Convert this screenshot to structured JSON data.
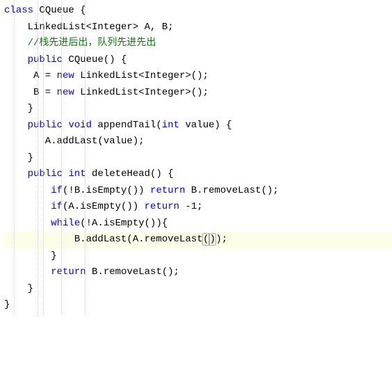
{
  "code": {
    "l1_kw_class": "class",
    "l1_name": " CQueue {",
    "l2_pre": "    LinkedList<Integer> A, B;",
    "l3_cmt": "    //栈先进后出，队列先进先出",
    "l4_a": "    ",
    "l4_kw": "public",
    "l4_b": " CQueue() {",
    "l5_a": "     A = ",
    "l5_kw": "new",
    "l5_b": " LinkedList<Integer>();",
    "l6_a": "     B = ",
    "l6_kw": "new",
    "l6_b": " LinkedList<Integer>();",
    "l7": "    }",
    "l8_a": "    ",
    "l8_kw1": "public",
    "l8_sp": " ",
    "l8_kw2": "void",
    "l8_b": " appendTail(",
    "l8_kw3": "int",
    "l8_c": " value) {",
    "l9": "       A.addLast(value);",
    "l10": "    }",
    "l11_a": "    ",
    "l11_kw1": "public",
    "l11_sp": " ",
    "l11_kw2": "int",
    "l11_b": " deleteHead() {",
    "l12_a": "        ",
    "l12_kw1": "if",
    "l12_b": "(!B.isEmpty()) ",
    "l12_kw2": "return",
    "l12_c": " B.removeLast();",
    "l13_a": "        ",
    "l13_kw1": "if",
    "l13_b": "(A.isEmpty()) ",
    "l13_kw2": "return",
    "l13_c": " -1;",
    "l14_a": "        ",
    "l14_kw": "while",
    "l14_b": "(!A.isEmpty()){",
    "l15_a": "            B.addLast(A.removeLast",
    "l15_p1": "(",
    "l15_p2": ")",
    "l15_b": ");",
    "l16": "        }",
    "l17_a": "        ",
    "l17_kw": "return",
    "l17_b": " B.removeLast();",
    "l18": "    }",
    "l19": "}"
  }
}
